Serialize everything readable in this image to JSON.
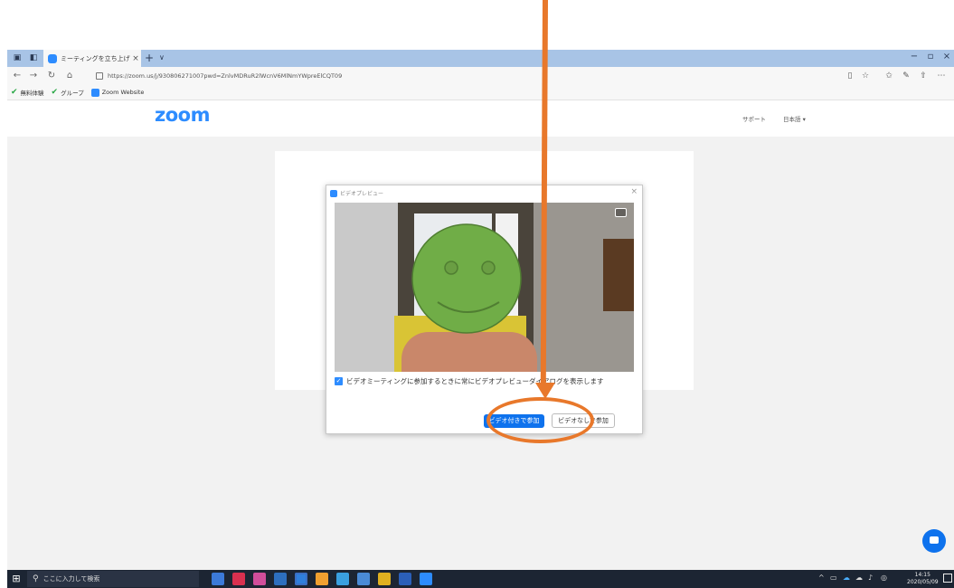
{
  "browser": {
    "tab_title": "ミーティングを立ち上げる - ;",
    "tab_close": "×",
    "tab_new": "+",
    "tab_dropdown": "∨",
    "url": "https://zoom.us/j/930806271007pwd=ZnlvMDRuR2lWcnV6MlNmYWpreElCQT09",
    "window_controls": [
      "−",
      "▫",
      "×"
    ]
  },
  "favorites": [
    {
      "label": "無料体験",
      "icon": "checkmark-icon"
    },
    {
      "label": "グループ",
      "icon": "checkmark-icon"
    },
    {
      "label": "Zoom Website",
      "icon": "zoom-icon"
    }
  ],
  "zoom_header": {
    "logo": "zoom",
    "support": "サポート",
    "language": "日本語 ▾"
  },
  "dialog": {
    "title": "ビデオプレビュー",
    "close": "×",
    "checkbox_label": "ビデオミーティングに参加するときに常にビデオプレビューダイアログを表示します",
    "checkbox_checked": true,
    "join_with_video": "ビデオ付きで参加",
    "join_without_video": "ビデオなしで参加"
  },
  "taskbar": {
    "search_placeholder": "ここに入力して検索",
    "time": "14:15",
    "date": "2020/05/09",
    "tray_chevron": "^"
  },
  "colors": {
    "zoom_blue": "#2d8cff",
    "join_button": "#0e72ed",
    "annotation": "#e8782b",
    "smiley": "#70ad47"
  }
}
